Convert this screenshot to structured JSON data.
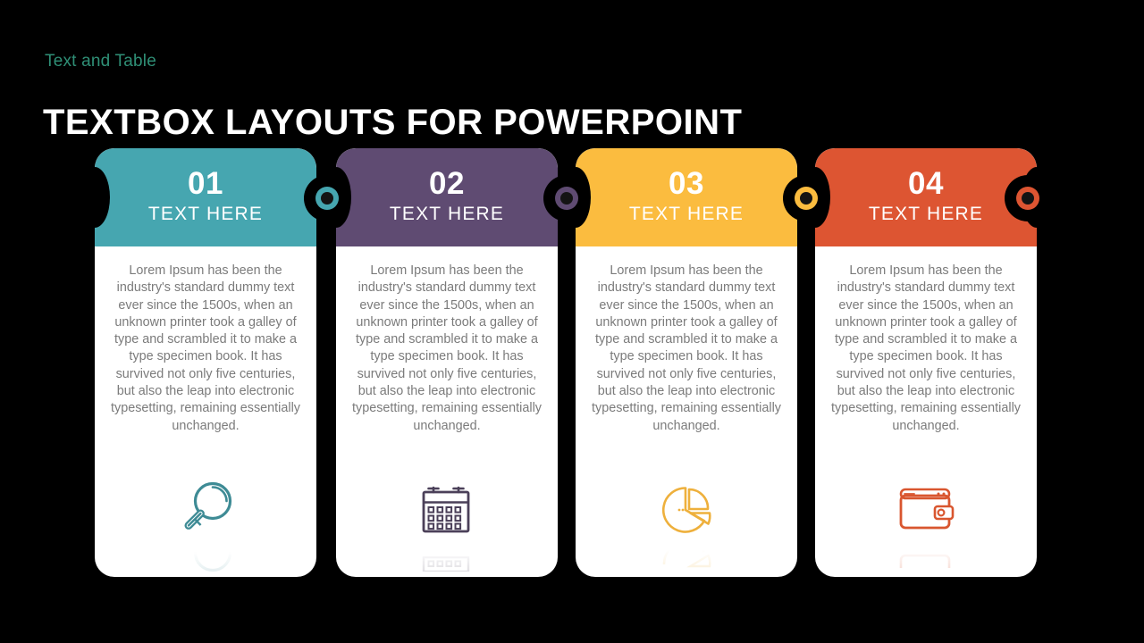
{
  "slide": {
    "eyebrow": "Text and Table",
    "title": "TEXTBOX LAYOUTS FOR POWERPOINT",
    "background_color": "#000000",
    "eyebrow_color": "#2f8f76",
    "title_color": "#ffffff",
    "body_text_color": "#7b7b7b",
    "card_background": "#ffffff"
  },
  "cards": [
    {
      "number": "01",
      "label": "TEXT HERE",
      "color": "#46a6b0",
      "icon": "magnifier-icon",
      "body": "Lorem Ipsum has been the industry's standard dummy text ever since the 1500s, when an unknown printer took a galley of type and scrambled it to make a type specimen book. It has survived not only five centuries, but also the leap into electronic typesetting, remaining essentially unchanged."
    },
    {
      "number": "02",
      "label": "TEXT HERE",
      "color": "#5f4b72",
      "icon": "calendar-icon",
      "body": "Lorem Ipsum has been the industry's standard dummy text ever since the 1500s, when an unknown printer took a galley of type and scrambled it to make a type specimen book. It has survived not only five centuries, but also the leap into electronic typesetting, remaining essentially unchanged."
    },
    {
      "number": "03",
      "label": "TEXT HERE",
      "color": "#fbbc3f",
      "icon": "pie-chart-icon",
      "body": "Lorem Ipsum has been the industry's standard dummy text ever since the 1500s, when an unknown printer took a galley of type and scrambled it to make a type specimen book. It has survived not only five centuries, but also the leap into electronic typesetting, remaining essentially unchanged."
    },
    {
      "number": "04",
      "label": "TEXT HERE",
      "color": "#dd5532",
      "icon": "wallet-icon",
      "body": "Lorem Ipsum has been the industry's standard dummy text ever since the 1500s, when an unknown printer took a galley of type and scrambled it to make a type specimen book. It has survived not only five centuries, but also the leap into electronic typesetting, remaining essentially unchanged."
    }
  ]
}
